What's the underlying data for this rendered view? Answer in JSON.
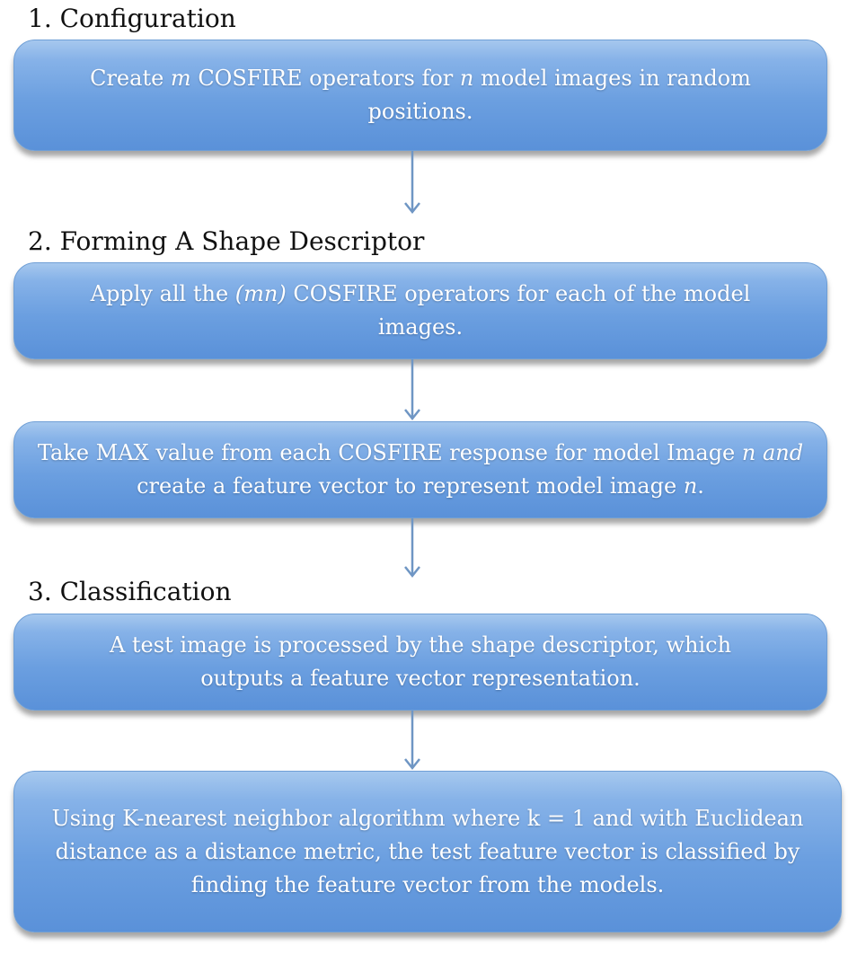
{
  "sections": {
    "configuration": {
      "title": "1. Configuration"
    },
    "shape_descriptor": {
      "title": "2. Forming A Shape Descriptor"
    },
    "classification": {
      "title": "3. Classification"
    }
  },
  "boxes": {
    "create_operators": {
      "t1": "Create ",
      "t2": "m",
      "t3": " COSFIRE operators for ",
      "t4": "n",
      "t5": " model images in random positions."
    },
    "apply_operators": {
      "t1": "Apply all the ",
      "t2": "(mn)",
      "t3": " COSFIRE operators for each of the model images."
    },
    "max_value": {
      "t1": "Take MAX value from each COSFIRE response for model Image ",
      "t2": "n and",
      "t3": " create a feature vector to represent model image ",
      "t4": "n",
      "t5": "."
    },
    "test_image": {
      "text": "A test image is processed by the shape descriptor, which outputs a feature vector representation."
    },
    "knn": {
      "text": "Using K-nearest neighbor algorithm where k = 1 and with Euclidean distance as a distance metric, the test feature vector is classified by finding the feature vector from the models."
    }
  },
  "colors": {
    "box_top": "#a6c8ee",
    "box_bottom": "#5a91d9",
    "arrow": "#6f96c4",
    "title": "#111111"
  }
}
